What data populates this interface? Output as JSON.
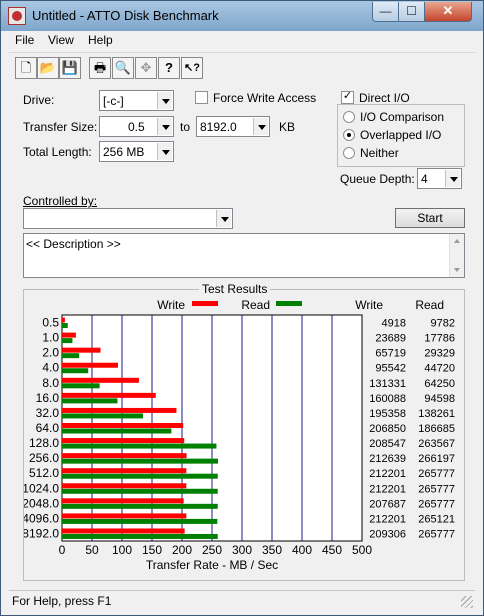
{
  "window": {
    "title": "Untitled - ATTO Disk Benchmark",
    "minimize": "—",
    "maximize": "☐",
    "close": "✕"
  },
  "menu": [
    "File",
    "View",
    "Help"
  ],
  "toolbar": [
    {
      "name": "new-icon",
      "glyph": "🗋"
    },
    {
      "name": "open-icon",
      "glyph": "📂"
    },
    {
      "name": "save-icon",
      "glyph": "💾"
    },
    {
      "name": "print-icon",
      "glyph": "🖶"
    },
    {
      "name": "print-preview-icon",
      "glyph": "🔍"
    },
    {
      "name": "move-icon",
      "glyph": "✥"
    },
    {
      "name": "help-icon",
      "glyph": "?"
    },
    {
      "name": "context-help-icon",
      "glyph": "↖?"
    }
  ],
  "form": {
    "drive_label": "Drive:",
    "drive_value": "[-c-]",
    "transfer_size_label": "Transfer Size:",
    "transfer_from": "0.5",
    "to_label": "to",
    "transfer_to": "8192.0",
    "kb_label": "KB",
    "total_length_label": "Total Length:",
    "total_length_value": "256 MB",
    "force_write_label": "Force Write Access",
    "force_write_checked": false,
    "direct_io_label": "Direct I/O",
    "direct_io_checked": true,
    "check_mark": "✓",
    "io_options": [
      {
        "label": "I/O Comparison",
        "selected": false
      },
      {
        "label": "Overlapped I/O",
        "selected": true
      },
      {
        "label": "Neither",
        "selected": false
      }
    ],
    "queue_depth_label": "Queue Depth:",
    "queue_depth_value": "4",
    "controlled_by_label": "Controlled by:",
    "controlled_by_value": "",
    "start_label": "Start",
    "description": "<< Description >>"
  },
  "results": {
    "title": "Test Results",
    "write_legend": "Write",
    "read_legend": "Read",
    "write_header": "Write",
    "read_header": "Read"
  },
  "chart_data": {
    "type": "bar",
    "orientation": "horizontal",
    "categories": [
      "0.5",
      "1.0",
      "2.0",
      "4.0",
      "8.0",
      "16.0",
      "32.0",
      "64.0",
      "128.0",
      "256.0",
      "512.0",
      "1024.0",
      "2048.0",
      "4096.0",
      "8192.0"
    ],
    "series": [
      {
        "name": "Write",
        "color": "#ff0000",
        "values": [
          4918,
          23689,
          65719,
          95542,
          131331,
          160088,
          195358,
          206850,
          208547,
          212639,
          212201,
          212201,
          207687,
          212201,
          209306
        ]
      },
      {
        "name": "Read",
        "color": "#008000",
        "values": [
          9782,
          17786,
          29329,
          44720,
          64250,
          94598,
          138261,
          186685,
          263567,
          266197,
          265777,
          265777,
          265777,
          265121,
          265777
        ]
      }
    ],
    "x_ticks": [
      "0",
      "50",
      "100",
      "150",
      "200",
      "250",
      "300",
      "350",
      "400",
      "450",
      "500"
    ],
    "xlim": [
      0,
      500
    ],
    "xlabel": "Transfer Rate - MB / Sec",
    "grid": true,
    "legend": "top"
  },
  "status": {
    "text": "For Help, press F1"
  }
}
